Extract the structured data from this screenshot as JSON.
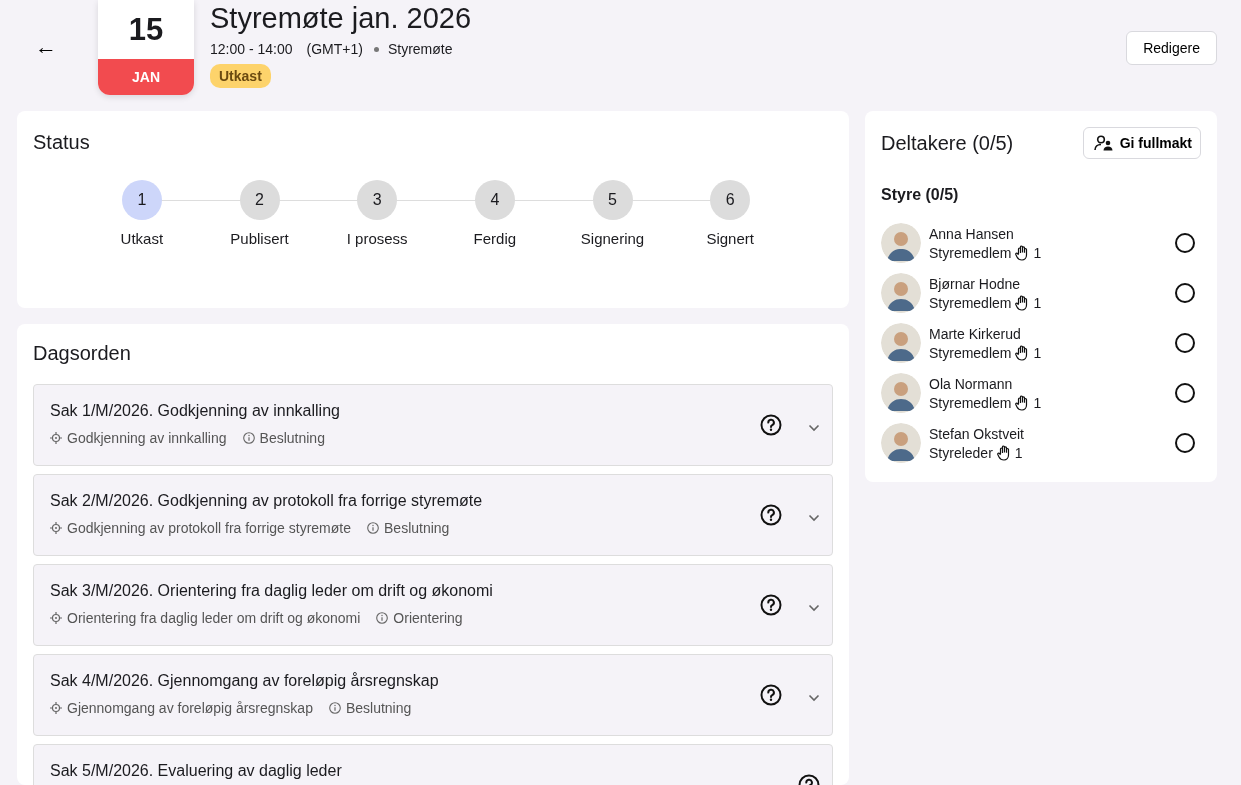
{
  "header": {
    "back_label": "←",
    "date": {
      "day": "15",
      "month": "JAN"
    },
    "title": "Styremøte jan. 2026",
    "time": "12:00 - 14:00",
    "timezone": "(GMT+1)",
    "meeting_type": "Styremøte",
    "status_badge": "Utkast",
    "edit_button": "Redigere"
  },
  "status": {
    "title": "Status",
    "steps": [
      {
        "number": "1",
        "label": "Utkast",
        "selected": true
      },
      {
        "number": "2",
        "label": "Publisert",
        "selected": false
      },
      {
        "number": "3",
        "label": "I prosess",
        "selected": false
      },
      {
        "number": "4",
        "label": "Ferdig",
        "selected": false
      },
      {
        "number": "5",
        "label": "Signering",
        "selected": false
      },
      {
        "number": "6",
        "label": "Signert",
        "selected": false
      }
    ]
  },
  "agenda": {
    "title": "Dagsorden",
    "items": [
      {
        "title": "Sak 1/M/2026. Godkjenning av innkalling",
        "goal": "Godkjenning av innkalling",
        "type": "Beslutning",
        "expanded": false
      },
      {
        "title": "Sak 2/M/2026. Godkjenning av protokoll fra forrige styremøte",
        "goal": "Godkjenning av protokoll fra forrige styremøte",
        "type": "Beslutning",
        "expanded": false
      },
      {
        "title": "Sak 3/M/2026. Orientering fra daglig leder om drift og økonomi",
        "goal": "Orientering fra daglig leder om drift og økonomi",
        "type": "Orientering",
        "expanded": false
      },
      {
        "title": "Sak 4/M/2026. Gjennomgang av foreløpig årsregnskap",
        "goal": "Gjennomgang av foreløpig årsregnskap",
        "type": "Beslutning",
        "expanded": false
      },
      {
        "title": "Sak 5/M/2026. Evaluering av daglig leder"
      }
    ]
  },
  "participants": {
    "title": "Deltakere (0/5)",
    "proxy_button": "Gi fullmakt",
    "group": "Styre (0/5)",
    "members": [
      {
        "name": "Anna Hansen",
        "role": "Styremedlem",
        "votes": "1",
        "checked": false
      },
      {
        "name": "Bjørnar Hodne",
        "role": "Styremedlem",
        "votes": "1",
        "checked": false
      },
      {
        "name": "Marte Kirkerud",
        "role": "Styremedlem",
        "votes": "1",
        "checked": false
      },
      {
        "name": "Ola Normann",
        "role": "Styremedlem",
        "votes": "1",
        "checked": false
      },
      {
        "name": "Stefan Okstveit",
        "role": "Styreleder",
        "votes": "1",
        "checked": false
      }
    ]
  }
}
